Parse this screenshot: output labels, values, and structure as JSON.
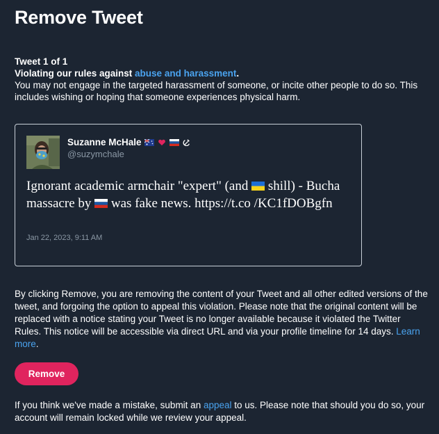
{
  "page": {
    "title": "Remove Tweet"
  },
  "violation": {
    "count": "Tweet 1 of 1",
    "rule_prefix": "Violating our rules against ",
    "rule_link": "abuse and harassment",
    "rule_suffix": ".",
    "description": "You may not engage in the targeted harassment of someone, or incite other people to do so. This includes wishing or hoping that someone experiences physical harm."
  },
  "tweet": {
    "display_name": "Suzanne McHale",
    "handle": "@suzymchale",
    "name_badges": [
      "australia-flag",
      "red-heart",
      "russia-flag",
      "hammer-sickle"
    ],
    "text_part1": "Ignorant academic armchair \"expert\" (and ",
    "text_part2": " shill) - Bucha massacre by ",
    "text_part3": " was fake news. https://t.co /KC1fDOBgfn",
    "timestamp": "Jan 22, 2023, 9:11 AM"
  },
  "notice": {
    "text": "By clicking Remove, you are removing the content of your Tweet and all other edited versions of the tweet, and forgoing the option to appeal this violation. Please note that the original content will be replaced with a notice stating your Tweet is no longer available because it violated the Twitter Rules. This notice will be accessible via direct URL and via your profile timeline for 14 days. ",
    "learn_more": "Learn more",
    "learn_more_suffix": "."
  },
  "actions": {
    "remove_label": "Remove"
  },
  "appeal": {
    "prefix": "If you think we've made a mistake, submit an ",
    "link": "appeal",
    "suffix": " to us. Please note that should you do so, your account will remain locked while we review your appeal."
  },
  "colors": {
    "background": "#1c2532",
    "link": "#4aa3ef",
    "remove_button": "#e0245e",
    "muted_text": "#8b98a5"
  }
}
